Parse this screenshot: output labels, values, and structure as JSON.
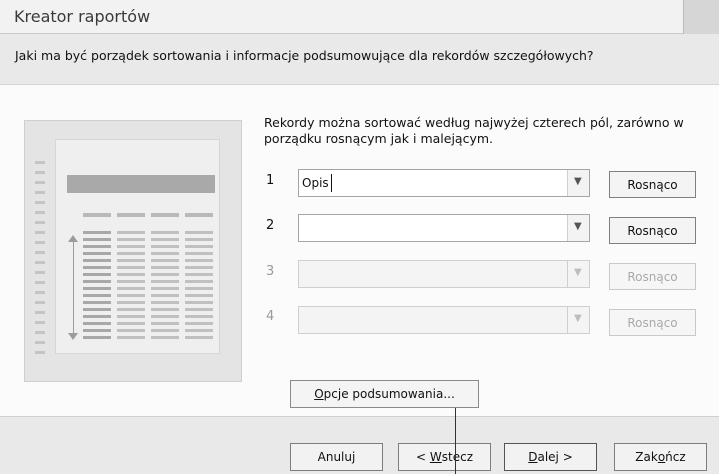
{
  "window": {
    "title": "Kreator raportów"
  },
  "question": "Jaki ma być porządek sortowania i informacje podsumowujące dla rekordów szczegółowych?",
  "description": "Rekordy można sortować według najwyżej czterech pól, zarówno w porządku rosnącym jak i malejącym.",
  "sort_rows": [
    {
      "number": "1",
      "value": "Opis",
      "button": "Rosnąco",
      "enabled": true
    },
    {
      "number": "2",
      "value": "",
      "button": "Rosnąco",
      "enabled": true
    },
    {
      "number": "3",
      "value": "",
      "button": "Rosnąco",
      "enabled": false
    },
    {
      "number": "4",
      "value": "",
      "button": "Rosnąco",
      "enabled": false
    }
  ],
  "summary_button": {
    "prefix_underlined": "O",
    "rest": "pcje podsumowania..."
  },
  "footer": {
    "cancel": "Anuluj",
    "back": {
      "before": "< ",
      "underlined": "W",
      "after": "stecz"
    },
    "next": {
      "underlined": "D",
      "after": "alej >"
    },
    "finish": {
      "before": "Zak",
      "underlined": "o",
      "after": "ńcz"
    }
  },
  "icons": {
    "dropdown": "chevron-down-icon",
    "close": "close-icon"
  }
}
